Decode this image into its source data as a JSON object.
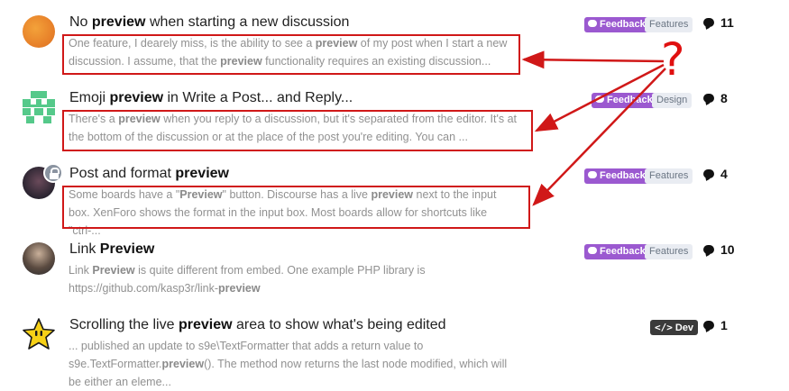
{
  "topics": [
    {
      "title_parts": [
        {
          "t": "No ",
          "b": false
        },
        {
          "t": "preview",
          "b": true
        },
        {
          "t": " when starting a new discussion",
          "b": false
        }
      ],
      "excerpt_parts": [
        {
          "t": "One feature, I dearely miss, is the ability to see a ",
          "b": false
        },
        {
          "t": "preview",
          "b": true
        },
        {
          "t": " of my post when I start a new discussion. I assume, that the ",
          "b": false
        },
        {
          "t": "preview",
          "b": true
        },
        {
          "t": " functionality requires an existing discussion...",
          "b": false
        }
      ],
      "tag_primary": "Feedback",
      "tag_secondary": "Features",
      "replies": "11"
    },
    {
      "title_parts": [
        {
          "t": "Emoji ",
          "b": false
        },
        {
          "t": "preview",
          "b": true
        },
        {
          "t": " in Write a Post... and Reply...",
          "b": false
        }
      ],
      "excerpt_parts": [
        {
          "t": "There's a ",
          "b": false
        },
        {
          "t": "preview",
          "b": true
        },
        {
          "t": " when you reply to a discussion, but it's separated from the editor. It's at the bottom of the discussion or at the place of the post you're editing. You can ...",
          "b": false
        }
      ],
      "tag_primary": "Feedback",
      "tag_secondary": "Design",
      "replies": "8"
    },
    {
      "title_parts": [
        {
          "t": "Post and format ",
          "b": false
        },
        {
          "t": "preview",
          "b": true
        }
      ],
      "excerpt_parts": [
        {
          "t": "Some boards have a \"",
          "b": false
        },
        {
          "t": "Preview",
          "b": true
        },
        {
          "t": "\" button. Discourse has a live ",
          "b": false
        },
        {
          "t": "preview",
          "b": true
        },
        {
          "t": " next to the input box. XenForo shows the format in the input box. Most boards allow for shortcuts like \"ctrl-...",
          "b": false
        }
      ],
      "tag_primary": "Feedback",
      "tag_secondary": "Features",
      "replies": "4"
    },
    {
      "title_parts": [
        {
          "t": "Link ",
          "b": false
        },
        {
          "t": "Preview",
          "b": true
        }
      ],
      "excerpt_parts": [
        {
          "t": "Link ",
          "b": false
        },
        {
          "t": "Preview",
          "b": true
        },
        {
          "t": " is quite different from embed. One example PHP library is https://github.com/kasp3r/link-",
          "b": false
        },
        {
          "t": "preview",
          "b": true
        }
      ],
      "tag_primary": "Feedback",
      "tag_secondary": "Features",
      "replies": "10"
    },
    {
      "title_parts": [
        {
          "t": "Scrolling the live ",
          "b": false
        },
        {
          "t": "preview",
          "b": true
        },
        {
          "t": " area to show what's being edited",
          "b": false
        }
      ],
      "excerpt_parts": [
        {
          "t": "... published an update to s9e\\TextFormatter that adds a return value to s9e.TextFormatter.",
          "b": false
        },
        {
          "t": "preview",
          "b": true
        },
        {
          "t": "(). The method now returns the last node modified, which will be either an eleme...",
          "b": false
        }
      ],
      "tag_primary": "Dev",
      "replies": "1"
    }
  ],
  "annotation": {
    "symbol": "?",
    "color": "#d01818"
  },
  "colors": {
    "feedback_tag": "#9b59d0",
    "dev_tag": "#3a3a3a",
    "category_tag": "#e9ecf2"
  }
}
